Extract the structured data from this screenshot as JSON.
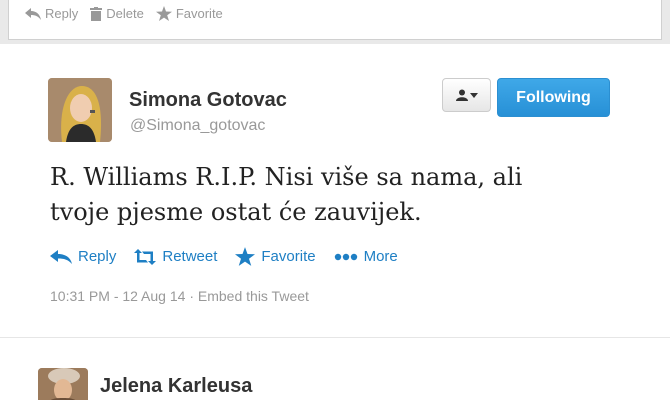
{
  "previous_tweet": {
    "actions": {
      "reply": "Reply",
      "delete": "Delete",
      "favorite": "Favorite"
    }
  },
  "tweet": {
    "author": {
      "name": "Simona Gotovac",
      "handle": "@Simona_gotovac"
    },
    "follow_button": "Following",
    "text_line1": "R. Williams R.I.P. Nisi više sa nama, ali",
    "text_line2": "tvoje pjesme ostat će zauvijek.",
    "actions": {
      "reply": "Reply",
      "retweet": "Retweet",
      "favorite": "Favorite",
      "more": "More"
    },
    "timestamp": "10:31 PM - 12 Aug 14",
    "embed": "Embed this Tweet"
  },
  "next_tweet": {
    "author": {
      "name": "Jelena Karleusa"
    }
  },
  "colors": {
    "link_blue": "#1e7fc4",
    "follow_blue": "#2b8fd1",
    "muted": "#999999"
  }
}
